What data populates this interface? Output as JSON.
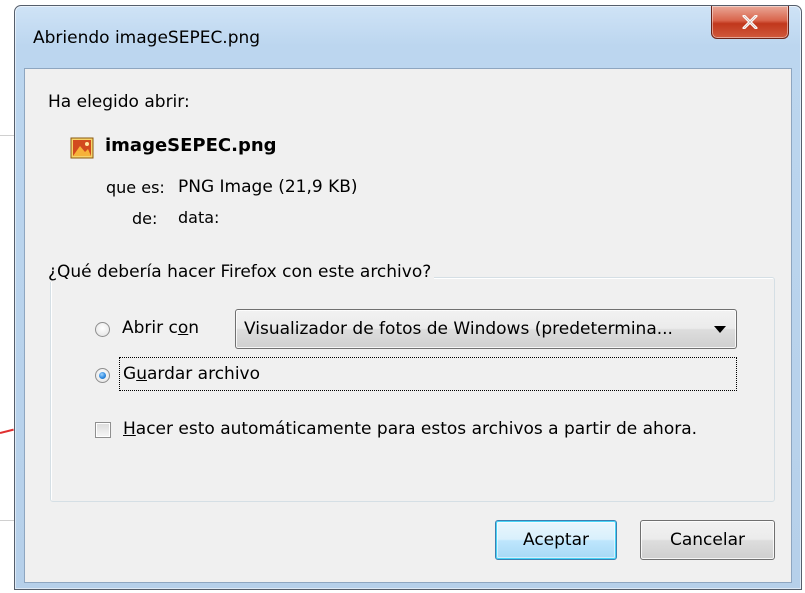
{
  "window": {
    "title": "Abriendo imageSEPEC.png",
    "close_label": "X"
  },
  "intro": {
    "chosen_label": "Ha elegido abrir:",
    "file_name": "imageSEPEC.png",
    "file_icon": "png-image-icon",
    "type_label": "que es:",
    "type_value": "PNG Image (21,9 KB)",
    "from_label": "de:",
    "from_value": "data:"
  },
  "action_group": {
    "legend": "¿Qué debería hacer Firefox con este archivo?",
    "open_with": {
      "label_pre": "Abrir c",
      "label_accel": "o",
      "label_post": "n",
      "selected": false
    },
    "app_select": {
      "value": "Visualizador de fotos de Windows (predetermina..."
    },
    "save_file": {
      "label_pre": "G",
      "label_accel": "u",
      "label_post": "ardar archivo",
      "selected": true
    },
    "auto": {
      "label_accel": "H",
      "label_post": "acer esto automáticamente para estos archivos a partir de ahora.",
      "checked": false
    }
  },
  "buttons": {
    "ok": "Aceptar",
    "cancel": "Cancelar"
  },
  "colors": {
    "frame": "#b9d1ea",
    "client": "#f0f0f0",
    "close_red": "#c1371c",
    "default_button": "#3c7fb1"
  }
}
